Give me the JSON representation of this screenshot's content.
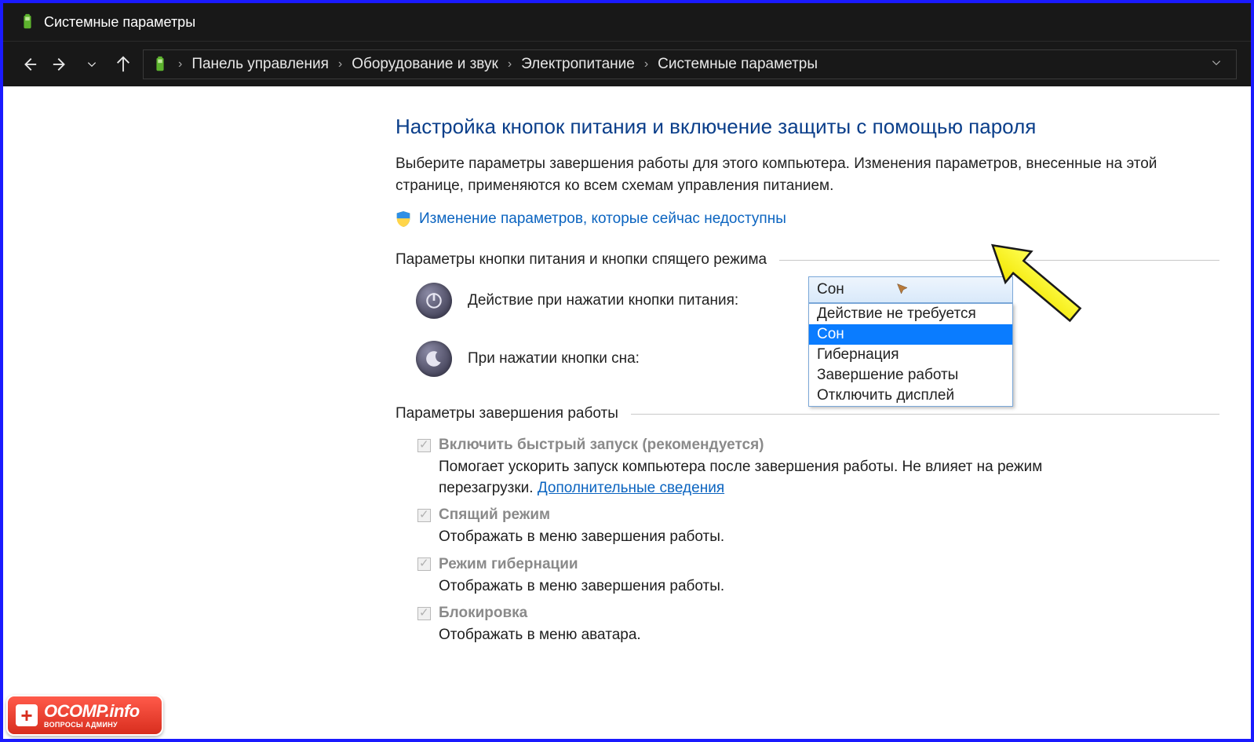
{
  "window": {
    "title": "Системные параметры"
  },
  "breadcrumb": {
    "items": [
      "Панель управления",
      "Оборудование и звук",
      "Электропитание",
      "Системные параметры"
    ]
  },
  "page": {
    "heading": "Настройка кнопок питания и включение защиты с помощью пароля",
    "description": "Выберите параметры завершения работы для этого компьютера. Изменения параметров, внесенные на этой странице, применяются ко всем схемам управления питанием.",
    "change_unavailable_link": "Изменение параметров, которые сейчас недоступны"
  },
  "sections": {
    "buttons_header": "Параметры кнопки питания и кнопки спящего режима",
    "shutdown_header": "Параметры завершения работы"
  },
  "power_button": {
    "label": "Действие при нажатии кнопки питания:",
    "selected": "Сон",
    "options": [
      "Действие не требуется",
      "Сон",
      "Гибернация",
      "Завершение работы",
      "Отключить дисплей"
    ]
  },
  "sleep_button": {
    "label": "При нажатии кнопки сна:"
  },
  "shutdown_items": [
    {
      "label": "Включить быстрый запуск (рекомендуется)",
      "desc_prefix": "Помогает ускорить запуск компьютера после завершения работы. Не влияет на режим перезагрузки. ",
      "link": "Дополнительные сведения"
    },
    {
      "label": "Спящий режим",
      "desc": "Отображать в меню завершения работы."
    },
    {
      "label": "Режим гибернации",
      "desc": "Отображать в меню завершения работы."
    },
    {
      "label": "Блокировка",
      "desc": "Отображать в меню аватара."
    }
  ],
  "watermark": {
    "main": "OCOMP.info",
    "sub": "ВОПРОСЫ АДМИНУ"
  }
}
